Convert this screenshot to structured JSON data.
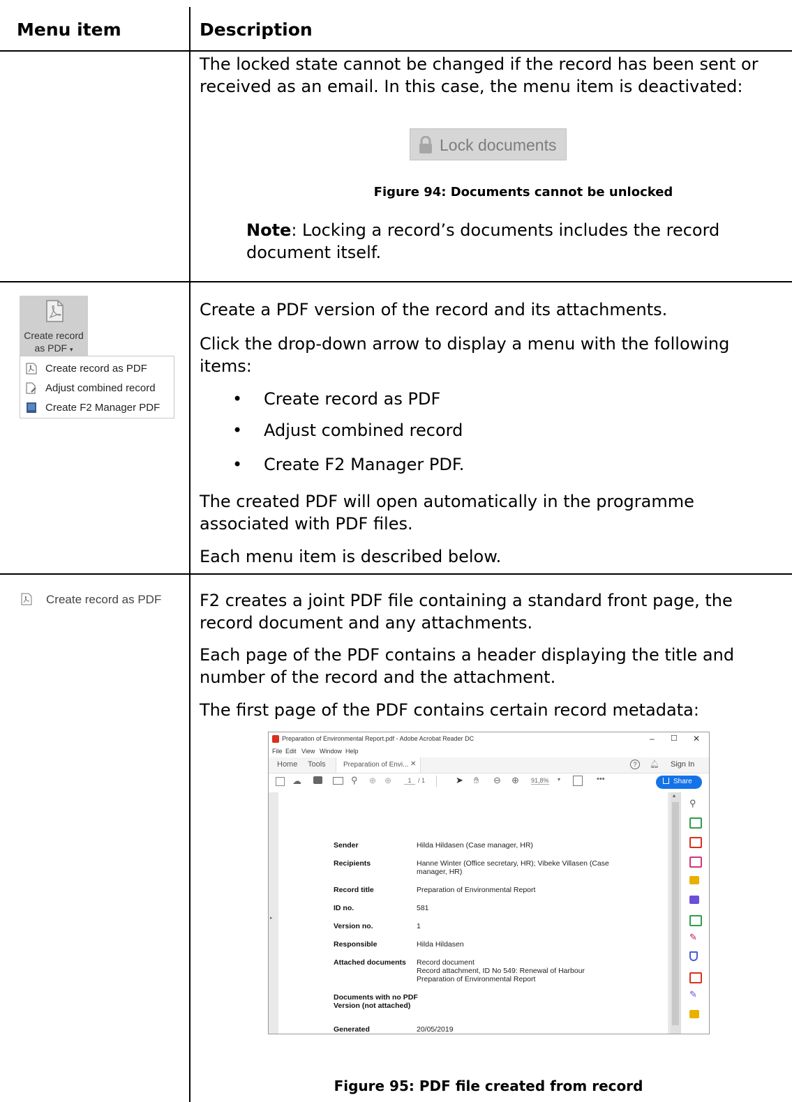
{
  "table": {
    "headers": {
      "menu_item": "Menu item",
      "description": "Description"
    }
  },
  "row_lock": {
    "para": "The locked state cannot be changed if the record has been sent or received as an email. In this case, the menu item is deactivated:",
    "button_label": "Lock documents",
    "figure_caption": "Figure 94: Documents cannot be unlocked",
    "note_label": "Note",
    "note_text": ": Locking a record’s documents includes the record document itself."
  },
  "row_pdf": {
    "ribbon_label_line1": "Create record",
    "ribbon_label_line2": "as PDF",
    "menu_items": [
      "Create record as PDF",
      "Adjust combined record",
      "Create F2 Manager PDF"
    ],
    "para1": "Create a PDF version of the record and its attachments.",
    "para2": "Click the drop-down arrow to display a menu with the following items:",
    "bullets": [
      "Create record as PDF",
      "Adjust combined record",
      "Create F2 Manager PDF."
    ],
    "para3": "The created PDF will open automatically in the programme associated with PDF files.",
    "para4": "Each menu item is described below."
  },
  "row_create": {
    "label": "Create record as PDF",
    "para1": "F2 creates a joint PDF file containing a standard front page, the record document and any attachments.",
    "para2": "Each page of the PDF contains a header displaying the title and number of the record and the attachment.",
    "para3": "The first page of the PDF contains certain record metadata:",
    "figure_caption": "Figure 95: PDF file created from record"
  },
  "acrobat": {
    "title": "Preparation of Environmental Report.pdf - Adobe Acrobat Reader DC",
    "menu": [
      "File",
      "Edit",
      "View",
      "Window",
      "Help"
    ],
    "tabs": [
      "Home",
      "Tools",
      "Preparation of Envi..."
    ],
    "sign_in": "Sign In",
    "page_current": "1",
    "page_total": "/ 1",
    "zoom": "91,8%",
    "share": "Share",
    "metadata": [
      {
        "key": "Sender",
        "value": "Hilda Hildasen (Case manager, HR)"
      },
      {
        "key": "Recipients",
        "value": "Hanne Winter (Office secretary, HR); Vibeke Villasen (Case\nmanager, HR)"
      },
      {
        "key": "Record title",
        "value": "Preparation of Environmental Report"
      },
      {
        "key": "ID no.",
        "value": "581"
      },
      {
        "key": "Version no.",
        "value": "1"
      },
      {
        "key": "Responsible",
        "value": "Hilda Hildasen"
      },
      {
        "key": "Attached documents",
        "value": "Record document\nRecord attachment, ID No 549: Renewal of Harbour\nPreparation of Environmental Report"
      },
      {
        "key": "Documents with no PDF\nVersion (not attached)",
        "value": ""
      },
      {
        "key": "Generated",
        "value": "20/05/2019"
      }
    ]
  },
  "colors": {
    "acrobat_red": "#d9301f",
    "share_blue": "#1473e6",
    "disabled_gray": "#d6d6d6"
  }
}
